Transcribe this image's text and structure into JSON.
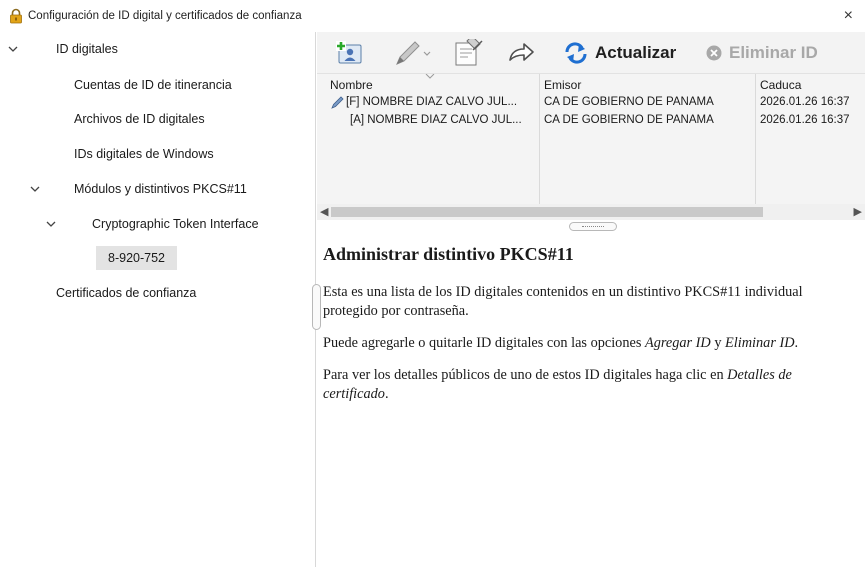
{
  "window": {
    "title": "Configuración de ID digital y certificados de confianza",
    "close_glyph": "×"
  },
  "tree": {
    "items": [
      {
        "label": "ID digitales",
        "expanded": true
      },
      {
        "label": "Cuentas de ID de itinerancia"
      },
      {
        "label": "Archivos de ID digitales"
      },
      {
        "label": "IDs digitales de Windows"
      },
      {
        "label": "Módulos y distintivos PKCS#11",
        "expanded": true
      },
      {
        "label": "Cryptographic Token Interface",
        "expanded": true
      },
      {
        "label": "8-920-752",
        "selected": true
      },
      {
        "label": "Certificados de confianza"
      }
    ]
  },
  "toolbar": {
    "add_icon": "add-id-icon",
    "sign_icon": "pen-icon",
    "details_icon": "certificate-details-icon",
    "export_icon": "export-arrow-icon",
    "refresh_label": "Actualizar",
    "remove_label": "Eliminar ID"
  },
  "table": {
    "columns": [
      "Nombre",
      "Emisor",
      "Caduca"
    ],
    "rows": [
      {
        "nombre": "[F] NOMBRE DIAZ CALVO JUL...",
        "emisor": "CA DE GOBIERNO DE PANAMA",
        "caduca": "2026.01.26 16:37",
        "icon": "pen-icon"
      },
      {
        "nombre": "[A] NOMBRE DIAZ CALVO JUL...",
        "emisor": "CA DE GOBIERNO DE PANAMA",
        "caduca": "2026.01.26 16:37"
      }
    ]
  },
  "help": {
    "heading": "Administrar distintivo PKCS#11",
    "p1": "Esta es una lista de los ID digitales contenidos en un distintivo PKCS#11 individual protegido por contraseña.",
    "p2_pre": "Puede agregarle o quitarle ID digitales con las opciones ",
    "p2_em1": "Agregar ID",
    "p2_mid": " y ",
    "p2_em2": "Eliminar ID",
    "p2_post": ".",
    "p3_pre": "Para ver los detalles públicos de uno de estos ID digitales haga clic en ",
    "p3_em": "Detalles de certificado",
    "p3_post": "."
  },
  "colors": {
    "selected_bg": "#e3e3e3",
    "toolbar_bg": "#f3f3f3",
    "list_bg": "#f4f4f4",
    "refresh_icon": "#1f6fd1",
    "disabled_text": "#a8a8a8"
  }
}
